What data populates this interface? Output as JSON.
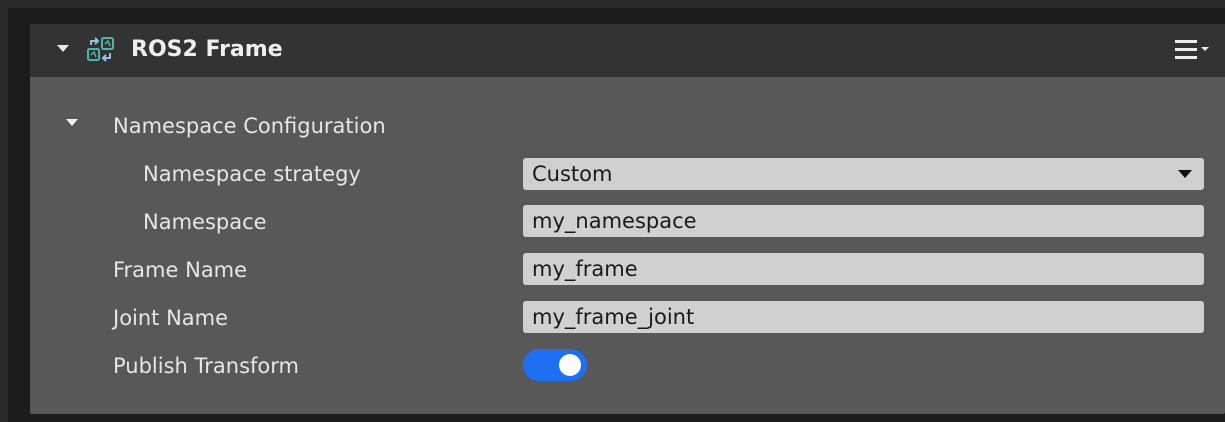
{
  "panel": {
    "title": "ROS2 Frame",
    "icon": "ros2-frame-icon",
    "menu_icon": "hamburger-menu-icon"
  },
  "namespace_section": {
    "label": "Namespace Configuration",
    "strategy_label": "Namespace strategy",
    "strategy_value": "Custom",
    "namespace_label": "Namespace",
    "namespace_value": "my_namespace"
  },
  "frame_name": {
    "label": "Frame Name",
    "value": "my_frame"
  },
  "joint_name": {
    "label": "Joint Name",
    "value": "my_frame_joint"
  },
  "publish_transform": {
    "label": "Publish Transform",
    "enabled": true
  },
  "colors": {
    "toggle_on": "#1e6ff2",
    "panel_bg": "#585858",
    "header_bg": "#333333"
  }
}
